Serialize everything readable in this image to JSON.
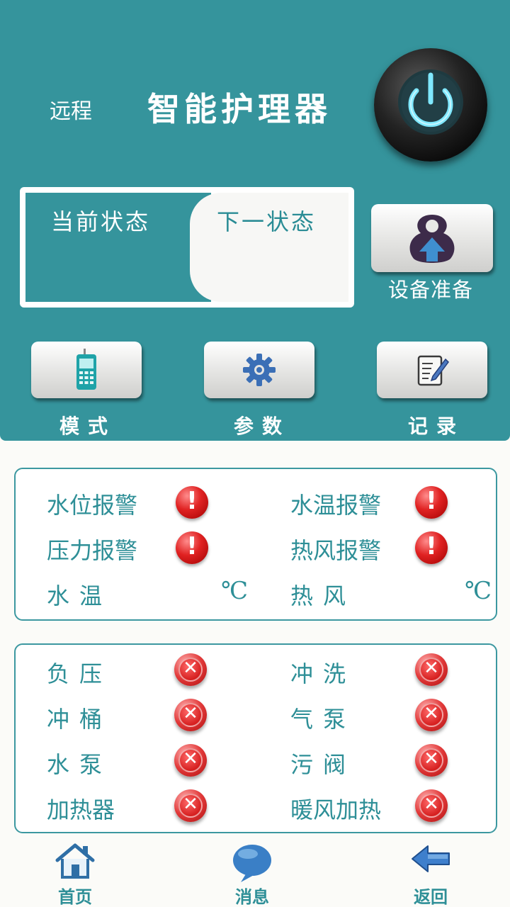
{
  "header": {
    "title_prefix": "远程",
    "title_main": "智能护理器",
    "power_icon": "power-icon"
  },
  "status": {
    "current_label": "当前状态",
    "next_label": "下一状态"
  },
  "device_prepare": {
    "label": "设备准备",
    "icon": "device-prepare-icon"
  },
  "controls": [
    {
      "label": "模式",
      "icon": "phone-icon"
    },
    {
      "label": "参数",
      "icon": "gear-icon"
    },
    {
      "label": "记录",
      "icon": "notepad-icon"
    }
  ],
  "alarms": {
    "water_level": "水位报警",
    "water_temp_alarm": "水温报警",
    "pressure": "压力报警",
    "hot_air_alarm": "热风报警",
    "water_temp": "水温",
    "hot_air": "热风",
    "unit": "℃"
  },
  "states": [
    {
      "label": "负压"
    },
    {
      "label": "冲洗"
    },
    {
      "label": "冲桶"
    },
    {
      "label": "气泵"
    },
    {
      "label": "水泵"
    },
    {
      "label": "污阀"
    },
    {
      "label": "加热器"
    },
    {
      "label": "暖风加热"
    }
  ],
  "nav": [
    {
      "label": "首页",
      "icon": "home-icon"
    },
    {
      "label": "消息",
      "icon": "message-icon"
    },
    {
      "label": "返回",
      "icon": "back-arrow-icon"
    }
  ],
  "colors": {
    "primary": "#35949c",
    "text": "#2e8f97",
    "alert": "#e02222"
  }
}
